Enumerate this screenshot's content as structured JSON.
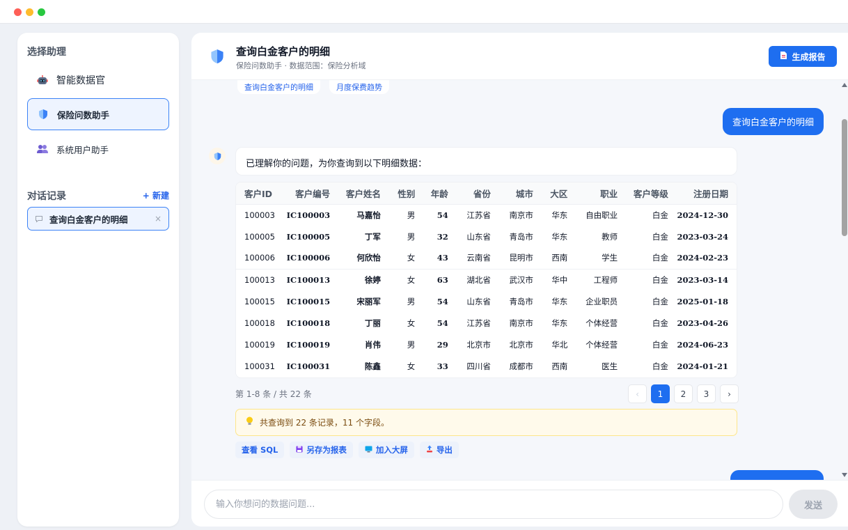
{
  "sidebar": {
    "select_heading": "选择助理",
    "assistants": [
      {
        "label": "智能数据官",
        "icon": "robot-icon"
      },
      {
        "label": "保险问数助手",
        "icon": "shield-icon",
        "active": true
      },
      {
        "label": "系统用户助手",
        "icon": "users-icon"
      }
    ],
    "history_heading": "对话记录",
    "new_label": "+ 新建",
    "history_items": [
      {
        "label": "查询白金客户的明细",
        "close": "×"
      }
    ]
  },
  "header": {
    "title": "查询白金客户的明细",
    "subtitle": "保险问数助手 · 数据范围：保险分析域",
    "report_button": "生成报告",
    "report_icon": "document-icon"
  },
  "chat": {
    "suggestions": [
      "查询白金客户的明细",
      "月度保费趋势"
    ],
    "user_message": "查询白金客户的明细",
    "bot_message": "已理解你的问题，为你查询到以下明细数据：",
    "table": {
      "columns": [
        "客户ID",
        "客户编号",
        "客户姓名",
        "性别",
        "年龄",
        "省份",
        "城市",
        "大区",
        "职业",
        "客户等级",
        "注册日期"
      ],
      "rows": [
        [
          "100003",
          "IC100003",
          "马嘉怡",
          "男",
          "54",
          "江苏省",
          "南京市",
          "华东",
          "自由职业",
          "白金",
          "2024-12-30"
        ],
        [
          "100005",
          "IC100005",
          "丁军",
          "男",
          "32",
          "山东省",
          "青岛市",
          "华东",
          "教师",
          "白金",
          "2023-03-24"
        ],
        [
          "100006",
          "IC100006",
          "何欣怡",
          "女",
          "43",
          "云南省",
          "昆明市",
          "西南",
          "学生",
          "白金",
          "2024-02-23"
        ],
        [
          "100013",
          "IC100013",
          "徐婷",
          "女",
          "63",
          "湖北省",
          "武汉市",
          "华中",
          "工程师",
          "白金",
          "2023-03-14"
        ],
        [
          "100015",
          "IC100015",
          "宋丽军",
          "男",
          "54",
          "山东省",
          "青岛市",
          "华东",
          "企业职员",
          "白金",
          "2025-01-18"
        ],
        [
          "100018",
          "IC100018",
          "丁丽",
          "女",
          "54",
          "江苏省",
          "南京市",
          "华东",
          "个体经营",
          "白金",
          "2023-04-26"
        ],
        [
          "100019",
          "IC100019",
          "肖伟",
          "男",
          "29",
          "北京市",
          "北京市",
          "华北",
          "个体经营",
          "白金",
          "2024-06-23"
        ],
        [
          "100031",
          "IC100031",
          "陈鑫",
          "女",
          "33",
          "四川省",
          "成都市",
          "西南",
          "医生",
          "白金",
          "2024-01-21"
        ]
      ]
    },
    "pager": {
      "info": "第 1-8 条 / 共 22 条",
      "prev": "‹",
      "pages": [
        "1",
        "2",
        "3"
      ],
      "current": "1",
      "next": "›"
    },
    "tip": "共查询到 22 条记录，11 个字段。",
    "actions": [
      {
        "label": "查看 SQL",
        "icon": ""
      },
      {
        "label": "另存为报表",
        "icon": "save-icon"
      },
      {
        "label": "加入大屏",
        "icon": "monitor-icon"
      },
      {
        "label": "导出",
        "icon": "export-icon"
      }
    ]
  },
  "composer": {
    "placeholder": "输入你想问的数据问题...",
    "value": "",
    "send_label": "发送"
  },
  "colors": {
    "accent": "#1e6ef0",
    "tip_bg": "#fffaeb",
    "tip_border": "#fde68a",
    "active_bg": "#eef4ff"
  }
}
